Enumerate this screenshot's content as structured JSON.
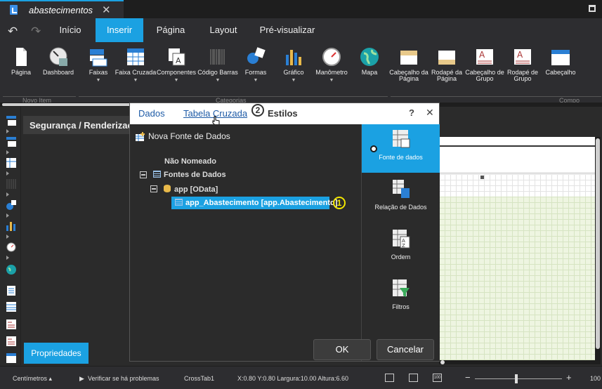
{
  "colors": {
    "accent": "#1ba1e2",
    "callout_yellow": "#f2e600"
  },
  "document_tab": {
    "title": "abastecimentos",
    "close": "✕"
  },
  "menu": {
    "undo_icon": "undo-icon",
    "redo_icon": "redo-icon",
    "tabs": [
      {
        "label": "Início"
      },
      {
        "label": "Inserir",
        "active": true
      },
      {
        "label": "Página"
      },
      {
        "label": "Layout"
      },
      {
        "label": "Pré-visualizar"
      }
    ]
  },
  "ribbon": {
    "items": [
      {
        "label": "Página",
        "icon": "page-icon"
      },
      {
        "label": "Dashboard",
        "icon": "dashboard-icon"
      },
      {
        "label": "Faixas",
        "icon": "bands-icon",
        "dropdown": true
      },
      {
        "label": "Faixa Cruzada",
        "icon": "cross-band-icon",
        "dropdown": true
      },
      {
        "label": "Componentes",
        "icon": "components-icon",
        "dropdown": true
      },
      {
        "label": "Código Barras",
        "icon": "barcode-icon",
        "dropdown": true
      },
      {
        "label": "Formas",
        "icon": "shapes-icon",
        "dropdown": true
      },
      {
        "label": "Gráfico",
        "icon": "chart-icon",
        "dropdown": true
      },
      {
        "label": "Manômetro",
        "icon": "gauge-icon",
        "dropdown": true
      },
      {
        "label": "Mapa",
        "icon": "map-icon"
      },
      {
        "label": "Cabeçalho da Página",
        "icon": "page-header-icon"
      },
      {
        "label": "Rodapé da Página",
        "icon": "page-footer-icon"
      },
      {
        "label": "Cabeçalho de Grupo",
        "icon": "group-header-icon"
      },
      {
        "label": "Rodapé de Grupo",
        "icon": "group-footer-icon"
      },
      {
        "label": "Cabeçalho",
        "icon": "header-icon"
      }
    ],
    "groups": [
      "Novo Item",
      "Categorias",
      "Compo"
    ]
  },
  "left_panel": {
    "title": "Segurança / Renderização",
    "properties_tab": "Propriedades"
  },
  "dialog": {
    "tabs": [
      "Dados",
      "Tabela Cruzada",
      "Estilos"
    ],
    "help": "?",
    "close": "✕",
    "callout_2": "2",
    "callout_1": "1",
    "new_datasource": "Nova Fonte de Dados",
    "tree": {
      "unnamed": "Não Nomeado",
      "datasources": "Fontes de Dados",
      "app": "app [OData]",
      "selected": "app_Abastecimento [app.Abastecimento]"
    },
    "side": [
      {
        "label": "Fonte de dados",
        "icon": "datasource-icon",
        "active": true
      },
      {
        "label": "Relação de Dados",
        "icon": "data-relation-icon"
      },
      {
        "label": "Ordem",
        "icon": "sort-icon"
      },
      {
        "label": "Filtros",
        "icon": "filter-icon"
      }
    ],
    "ok": "OK",
    "cancel": "Cancelar"
  },
  "statusbar": {
    "units": "Centímetros",
    "check": "Verificar se há problemas",
    "component": "CrossTab1",
    "position": "X:0.80 Y:0.80 Largura:10.00 Altura:6.60",
    "zoom_minus": "−",
    "zoom_plus": "+",
    "zoom": "100"
  }
}
